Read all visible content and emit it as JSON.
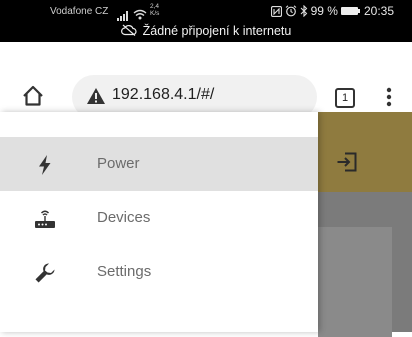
{
  "status_bar": {
    "carrier": "Vodafone CZ",
    "speed_value": "2,4",
    "speed_unit": "K/s",
    "battery_percent": "99 %",
    "time": "20:35",
    "notice": "Žádné připojení k internetu"
  },
  "browser": {
    "url": "192.168.4.1/#/",
    "tab_count": "1"
  },
  "colors": {
    "app_header": "#8f7b3f",
    "drawer_active": "#e0e0e0",
    "scrim": "#7b7b7b"
  },
  "drawer": {
    "items": [
      {
        "label": "Power",
        "icon": "bolt-icon",
        "active": true
      },
      {
        "label": "Devices",
        "icon": "router-icon",
        "active": false
      },
      {
        "label": "Settings",
        "icon": "wrench-icon",
        "active": false
      }
    ]
  }
}
